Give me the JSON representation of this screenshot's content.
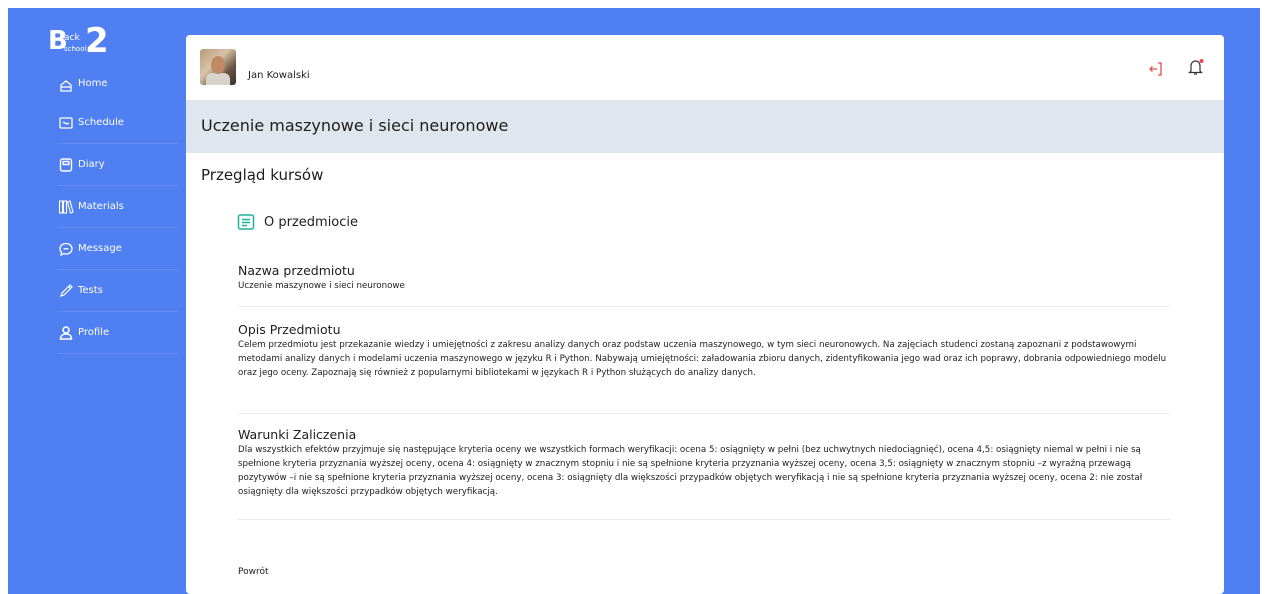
{
  "brand": {
    "logo_b": "B",
    "logo_ack": "ack",
    "logo_school": "school",
    "logo_two": "2"
  },
  "sidebar": {
    "items": [
      {
        "label": "Home",
        "icon": "home-icon"
      },
      {
        "label": "Schedule",
        "icon": "schedule-icon"
      },
      {
        "label": "Diary",
        "icon": "diary-icon"
      },
      {
        "label": "Materials",
        "icon": "materials-icon"
      },
      {
        "label": "Message",
        "icon": "message-icon"
      },
      {
        "label": "Tests",
        "icon": "pencil-icon"
      },
      {
        "label": "Profile",
        "icon": "person-icon"
      }
    ]
  },
  "header": {
    "user_name": "Jan Kowalski",
    "logout_icon": "logout-icon",
    "notification_icon": "bell-icon"
  },
  "course": {
    "title": "Uczenie maszynowe i sieci neuronowe"
  },
  "main": {
    "section_title": "Przegląd kursów",
    "about_label": "O przedmiocie",
    "subject_name_heading": "Nazwa przedmiotu",
    "subject_name_value": "Uczenie maszynowe i sieci neuronowe",
    "description_heading": "Opis Przedmiotu",
    "description_text": "Celem przedmiotu jest przekazanie wiedzy i umiejętności z zakresu analizy danych oraz podstaw uczenia maszynowego, w tym sieci neuronowych. Na zajęciach studenci zostaną zapoznani z podstawowymi metodami analizy danych i modelami uczenia maszynowego w języku R i Python. Nabywają umiejętności: załadowania zbioru danych, zidentyfikowania jego wad oraz ich poprawy, dobrania odpowiedniego modelu oraz jego oceny. Zapoznają się również z popularnymi bibliotekami w językach R i Python służących do analizy danych.",
    "conditions_heading": "Warunki Zaliczenia",
    "conditions_text": "Dla wszystkich efektów przyjmuje się następujące kryteria oceny we wszystkich formach weryfikacji: ocena 5: osiągnięty w pełni (bez uchwytnych niedociągnięć), ocena 4,5: osiągnięty niemal w pełni i nie są spełnione kryteria przyznania wyższej oceny, ocena 4: osiągnięty w znacznym stopniu i nie są spełnione kryteria przyznania wyższej oceny, ocena 3,5: osiągnięty w znacznym stopniu –z wyraźną przewagą pozytywów –i nie są spełnione kryteria przyznania wyższej oceny, ocena 3: osiągnięty dla większości przypadków objętych weryfikacją i nie są spełnione kryteria przyznania wyższej oceny, ocena 2: nie został osiągnięty dla większości przypadków objętych weryfikacją.",
    "back_label": "Powrót"
  },
  "colors": {
    "sidebar_bg": "#4f7ff0",
    "banner_bg": "#dfe6ee",
    "accent_teal": "#1bb39a",
    "accent_red": "#e84a4a"
  }
}
